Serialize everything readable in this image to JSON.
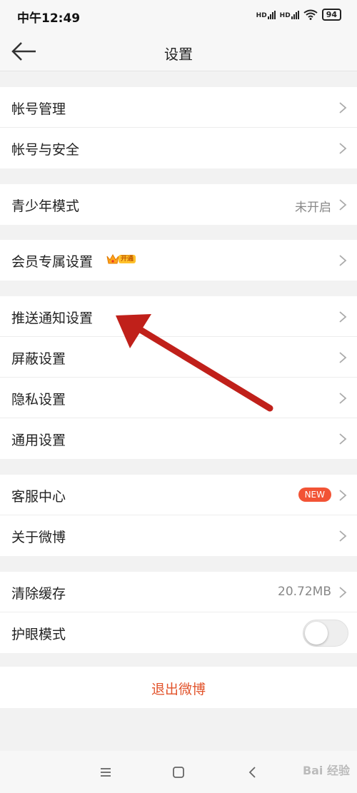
{
  "status_bar": {
    "time": "中午12:49",
    "battery": "94",
    "network_1": "HD",
    "network_2": "HD"
  },
  "header": {
    "title": "设置"
  },
  "groups": [
    {
      "items": [
        {
          "label": "帐号管理"
        },
        {
          "label": "帐号与安全"
        }
      ]
    },
    {
      "items": [
        {
          "label": "青少年模式",
          "value": "未开启"
        }
      ]
    },
    {
      "items": [
        {
          "label": "会员专属设置",
          "vip_tag": "开通"
        }
      ]
    },
    {
      "items": [
        {
          "label": "推送通知设置"
        },
        {
          "label": "屏蔽设置"
        },
        {
          "label": "隐私设置"
        },
        {
          "label": "通用设置"
        }
      ]
    },
    {
      "items": [
        {
          "label": "客服中心",
          "badge": "NEW"
        },
        {
          "label": "关于微博"
        }
      ]
    },
    {
      "items": [
        {
          "label": "清除缓存",
          "value": "20.72MB"
        },
        {
          "label": "护眼模式",
          "toggle": false
        }
      ]
    }
  ],
  "logout": {
    "label": "退出微博"
  },
  "watermark": "Bai 经验",
  "colors": {
    "accent_red": "#e2542c",
    "badge_red": "#f25335",
    "annotation_arrow": "#c0201a",
    "vip_gold": "#ffc12b"
  },
  "icons": {
    "back": "arrow-left-icon",
    "chevron": "chevron-right-icon",
    "menu": "menu-icon",
    "home": "home-square-icon",
    "nav_back": "back-triangle-icon"
  }
}
